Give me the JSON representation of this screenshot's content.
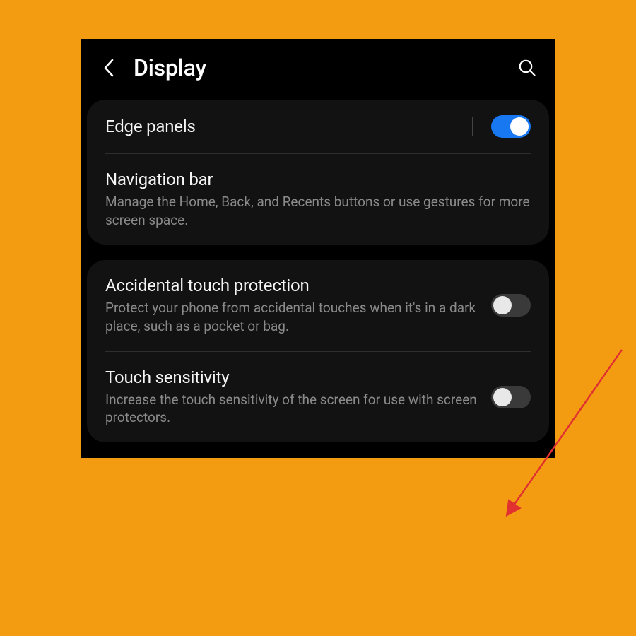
{
  "header": {
    "title": "Display"
  },
  "groups": [
    {
      "items": [
        {
          "id": "edge-panels",
          "title": "Edge panels",
          "desc": null,
          "toggle": true,
          "toggle_on": true,
          "vdivider": true
        },
        {
          "id": "navigation-bar",
          "title": "Navigation bar",
          "desc": "Manage the Home, Back, and Recents buttons or use gestures for more screen space.",
          "toggle": false
        }
      ]
    },
    {
      "items": [
        {
          "id": "accidental-touch",
          "title": "Accidental touch protection",
          "desc": "Protect your phone from accidental touches when it's in a dark place, such as a pocket or bag.",
          "toggle": true,
          "toggle_on": false
        },
        {
          "id": "touch-sensitivity",
          "title": "Touch sensitivity",
          "desc": "Increase the touch sensitivity of the screen for use with screen protectors.",
          "toggle": true,
          "toggle_on": false
        }
      ]
    }
  ],
  "annotation": {
    "type": "arrow",
    "target": "touch-sensitivity-toggle",
    "color": "#e74c3c"
  }
}
